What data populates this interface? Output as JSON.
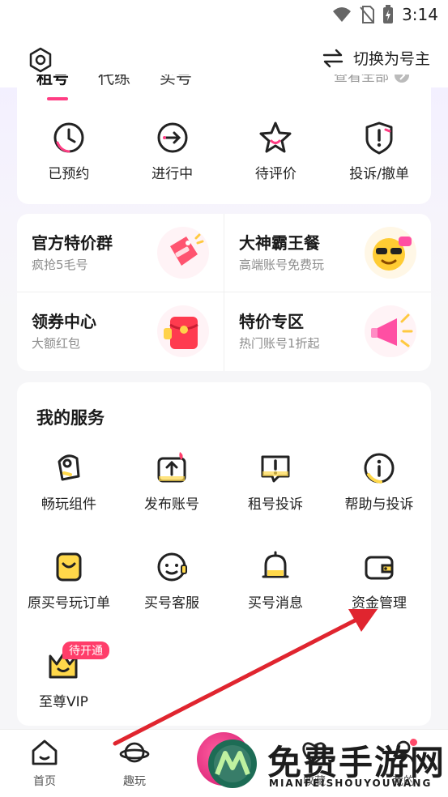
{
  "status_bar": {
    "time": "3:14"
  },
  "header": {
    "switch_label": "切换为号主"
  },
  "orders": {
    "tabs": [
      "租号",
      "代练",
      "买号"
    ],
    "view_all": "查看全部",
    "items": [
      {
        "label": "已预约",
        "icon": "clock-icon"
      },
      {
        "label": "进行中",
        "icon": "arrow-circle-icon"
      },
      {
        "label": "待评价",
        "icon": "star-icon"
      },
      {
        "label": "投诉/撤单",
        "icon": "shield-alert-icon"
      }
    ]
  },
  "promos": [
    {
      "title": "官方特价群",
      "subtitle": "疯抢5毛号",
      "icon": "price-tag-icon"
    },
    {
      "title": "大神霸王餐",
      "subtitle": "高端账号免费玩",
      "icon": "cool-face-icon"
    },
    {
      "title": "领券中心",
      "subtitle": "大额红包",
      "icon": "red-packet-icon"
    },
    {
      "title": "特价专区",
      "subtitle": "热门账号1折起",
      "icon": "megaphone-icon"
    }
  ],
  "services": {
    "title": "我的服务",
    "items": [
      {
        "label": "畅玩组件",
        "icon": "rocket-icon"
      },
      {
        "label": "发布账号",
        "icon": "upload-icon"
      },
      {
        "label": "租号投诉",
        "icon": "chat-alert-icon"
      },
      {
        "label": "帮助与投诉",
        "icon": "info-icon"
      },
      {
        "label": "原买号玩订单",
        "icon": "bag-icon"
      },
      {
        "label": "买号客服",
        "icon": "headset-icon"
      },
      {
        "label": "买号消息",
        "icon": "bell-icon"
      },
      {
        "label": "资金管理",
        "icon": "wallet-icon"
      },
      {
        "label": "至尊VIP",
        "icon": "vip-crown-icon"
      }
    ],
    "vip_badge": "待开通"
  },
  "bottom_nav": [
    {
      "label": "首页",
      "icon": "home-icon"
    },
    {
      "label": "趣玩",
      "icon": "planet-icon"
    },
    {
      "label": "收藏",
      "icon": "heart-icon"
    },
    {
      "label": "我的",
      "icon": "profile-icon"
    }
  ],
  "watermark": {
    "main": "免费手游网",
    "sub": "MIANFEISHOUYOUWANG"
  },
  "colors": {
    "accent": "#ff3d83",
    "arrow": "#e0252f",
    "icon_yellow": "#ffd84a"
  }
}
